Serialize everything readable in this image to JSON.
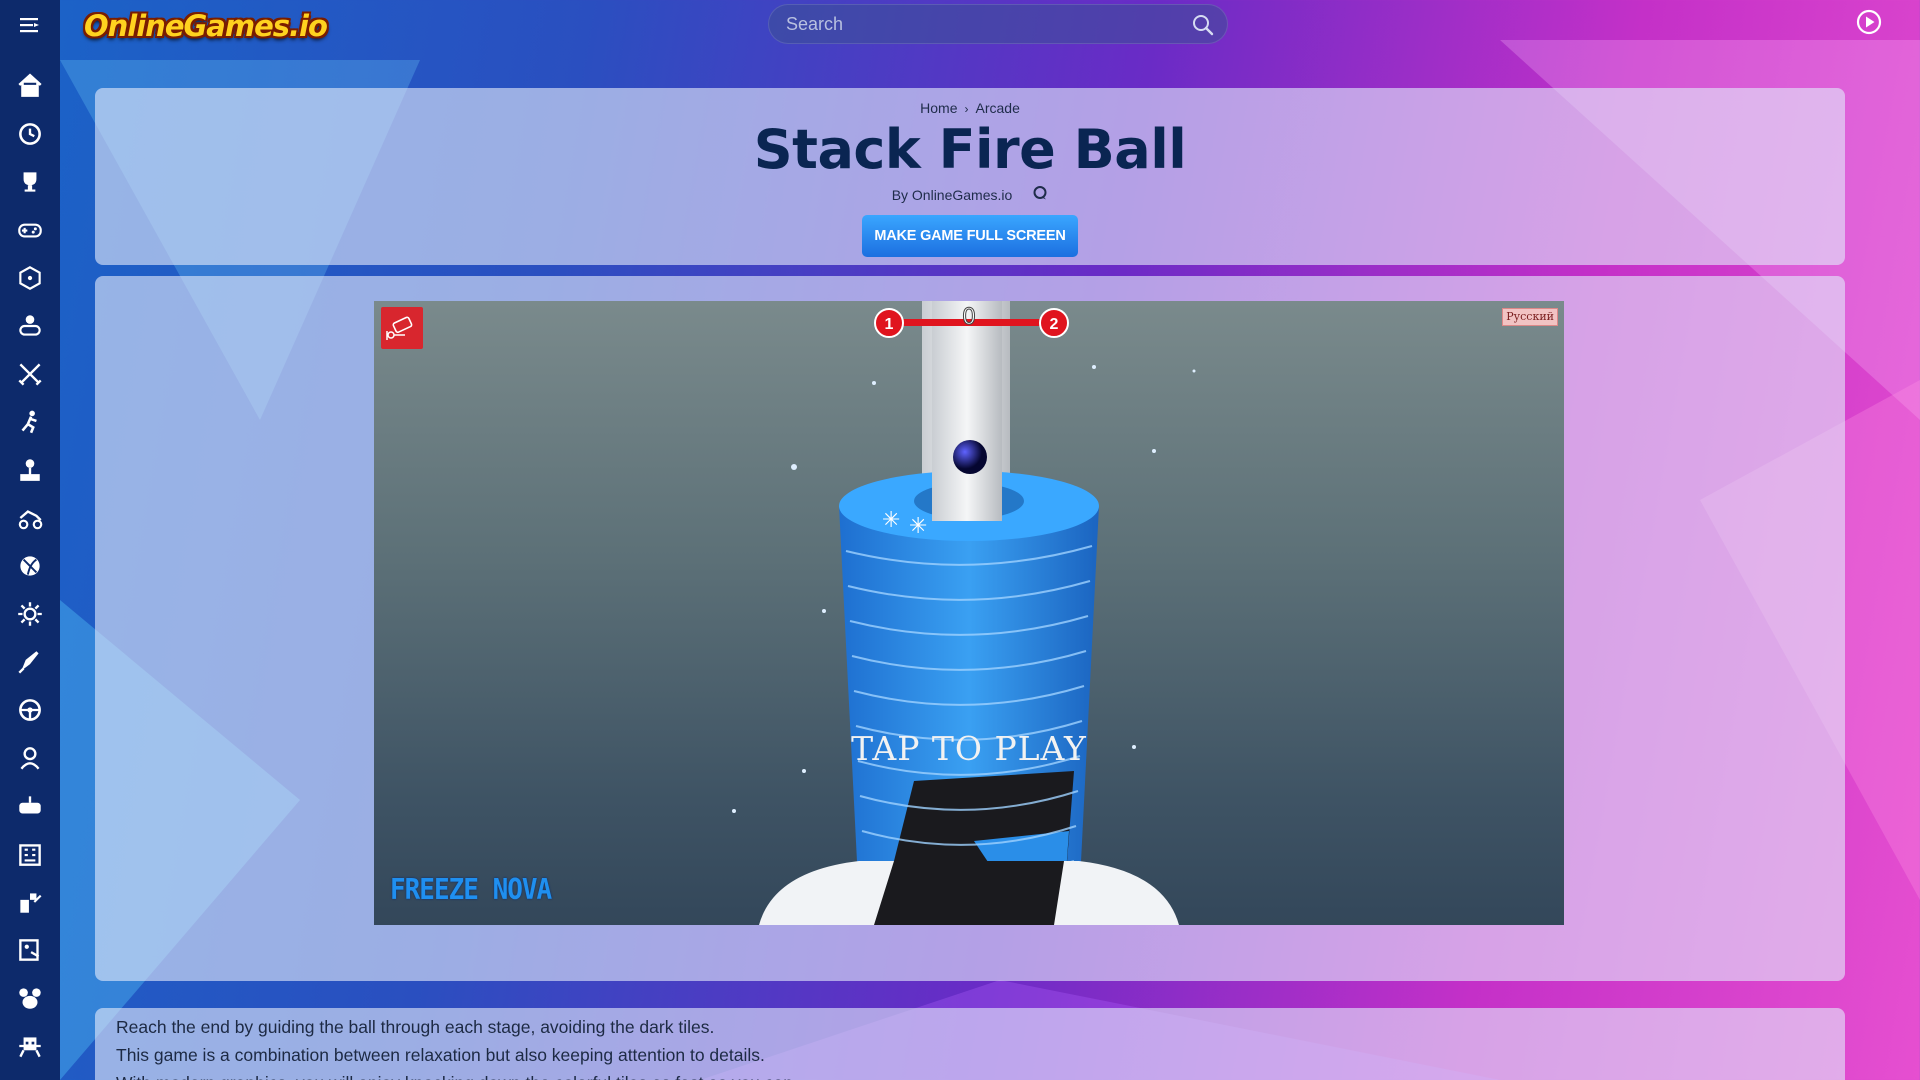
{
  "header": {
    "logo_text": "OnlineGames.io",
    "search_placeholder": "Search"
  },
  "sidebar": {
    "items": [
      {
        "icon": "home-icon"
      },
      {
        "icon": "history-icon"
      },
      {
        "icon": "trophy-icon"
      },
      {
        "icon": "gamepad-icon"
      },
      {
        "icon": "dice-icon"
      },
      {
        "icon": "multiplayer-icon"
      },
      {
        "icon": "swords-icon"
      },
      {
        "icon": "runner-icon"
      },
      {
        "icon": "joystick-icon"
      },
      {
        "icon": "racing-icon"
      },
      {
        "icon": "ball-icon"
      },
      {
        "icon": "gear-icon"
      },
      {
        "icon": "rocket-icon"
      },
      {
        "icon": "steering-wheel-icon"
      },
      {
        "icon": "girl-icon"
      },
      {
        "icon": "controller-icon"
      },
      {
        "icon": "building-icon"
      },
      {
        "icon": "blocks-icon"
      },
      {
        "icon": "puzzle-icon"
      },
      {
        "icon": "animals-icon"
      },
      {
        "icon": "alien-icon"
      }
    ]
  },
  "breadcrumb": {
    "home": "Home",
    "separator": "›",
    "category": "Arcade"
  },
  "game": {
    "title": "Stack Fire Ball",
    "byline": "By OnlineGames.io",
    "fullscreen_label": "MAKE GAME FULL SCREEN",
    "level_current": "1",
    "level_next": "2",
    "score": "0",
    "tap_to_play": "TAP TO PLAY",
    "language_button": "Русский",
    "brand_text": "FREEZE NOVA"
  },
  "description": {
    "lines": [
      "Reach the end by guiding the ball through each stage, avoiding the dark tiles.",
      "This game is a combination between relaxation but also keeping attention to details.",
      "With modern graphics, you will enjoy knocking down the colorful tiles as fast as you can."
    ]
  },
  "colors": {
    "sidebar_bg": "#0d2a6b",
    "title_color": "#0a2552",
    "button_blue": "#2b8cf0",
    "tower_blue": "#2a8ee8",
    "level_red": "#e0141e"
  }
}
